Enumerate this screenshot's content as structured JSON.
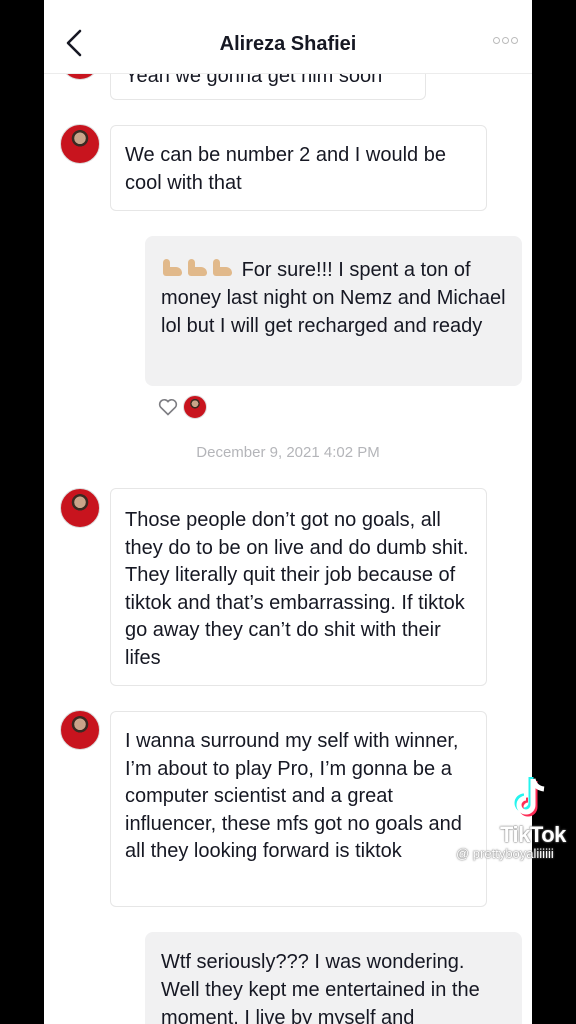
{
  "header": {
    "title": "Alireza Shafiei",
    "back_icon": "chevron-left-icon",
    "more_icon": "more-dots-icon"
  },
  "messages": [
    {
      "from": "them",
      "text": "Yeah we gonna get him soon"
    },
    {
      "from": "them",
      "text": "We can be number 2 and I would be cool with that"
    },
    {
      "from": "me",
      "emoji": [
        "flexed-biceps-icon",
        "flexed-biceps-icon",
        "flexed-biceps-icon"
      ],
      "text": "For sure!!! I spent a ton of money last night on Nemz and Michael lol but I will get recharged and ready",
      "liked": true
    },
    {
      "from": "them",
      "text": "Those people don’t got no goals, all they do to be on live and do dumb shit. They literally quit their job because of tiktok and that’s embarrassing. If tiktok go away they can’t do shit with their lifes"
    },
    {
      "from": "them",
      "text": "I wanna surround my self with winner, I’m about to play Pro, I’m gonna be a computer scientist and a great influencer, these mfs got no goals and all they looking forward is tiktok"
    },
    {
      "from": "me",
      "text": "Wtf seriously??? I was wondering. Well they kept me entertained in the moment. I live by myself and"
    }
  ],
  "timestamp": "December 9, 2021 4:02 PM",
  "watermark": {
    "brand": "TikTok",
    "handle": "@ prettyboyaliiiiii"
  },
  "colors": {
    "text": "#161823",
    "outgoing_bubble": "#f1f1f2",
    "timestamp": "#b4b5b9"
  }
}
